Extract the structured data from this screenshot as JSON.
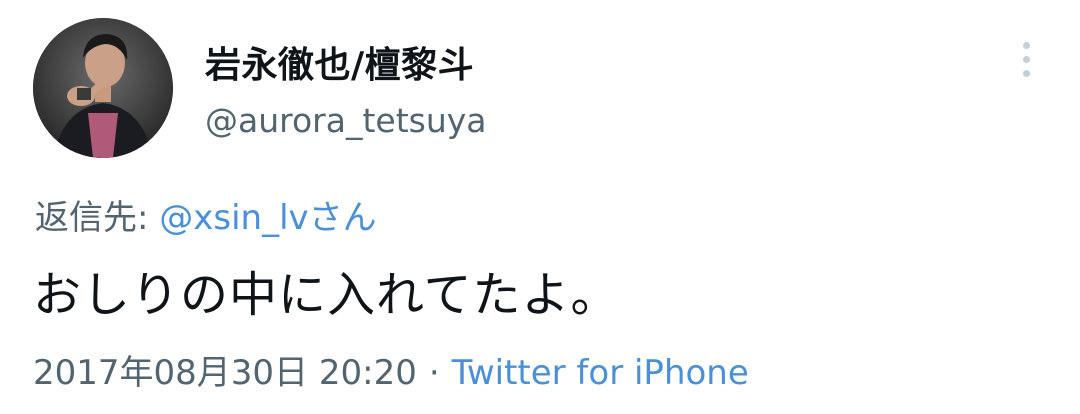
{
  "tweet": {
    "author": {
      "display_name": "岩永徹也/檀黎斗",
      "handle": "@aurora_tetsuya",
      "avatar_icon": "profile-photo"
    },
    "reply": {
      "prefix": "返信先: ",
      "mention": "@xsin_lvさん"
    },
    "text": "おしりの中に入れてたよ。",
    "timestamp": "2017年08月30日 20:20",
    "separator": "·",
    "source": "Twitter for iPhone",
    "more_icon": "vertical-dots-icon"
  },
  "colors": {
    "text": "#0f1419",
    "secondary": "#536471",
    "link": "#4a90d9",
    "more_dots": "#c4cfd6"
  }
}
